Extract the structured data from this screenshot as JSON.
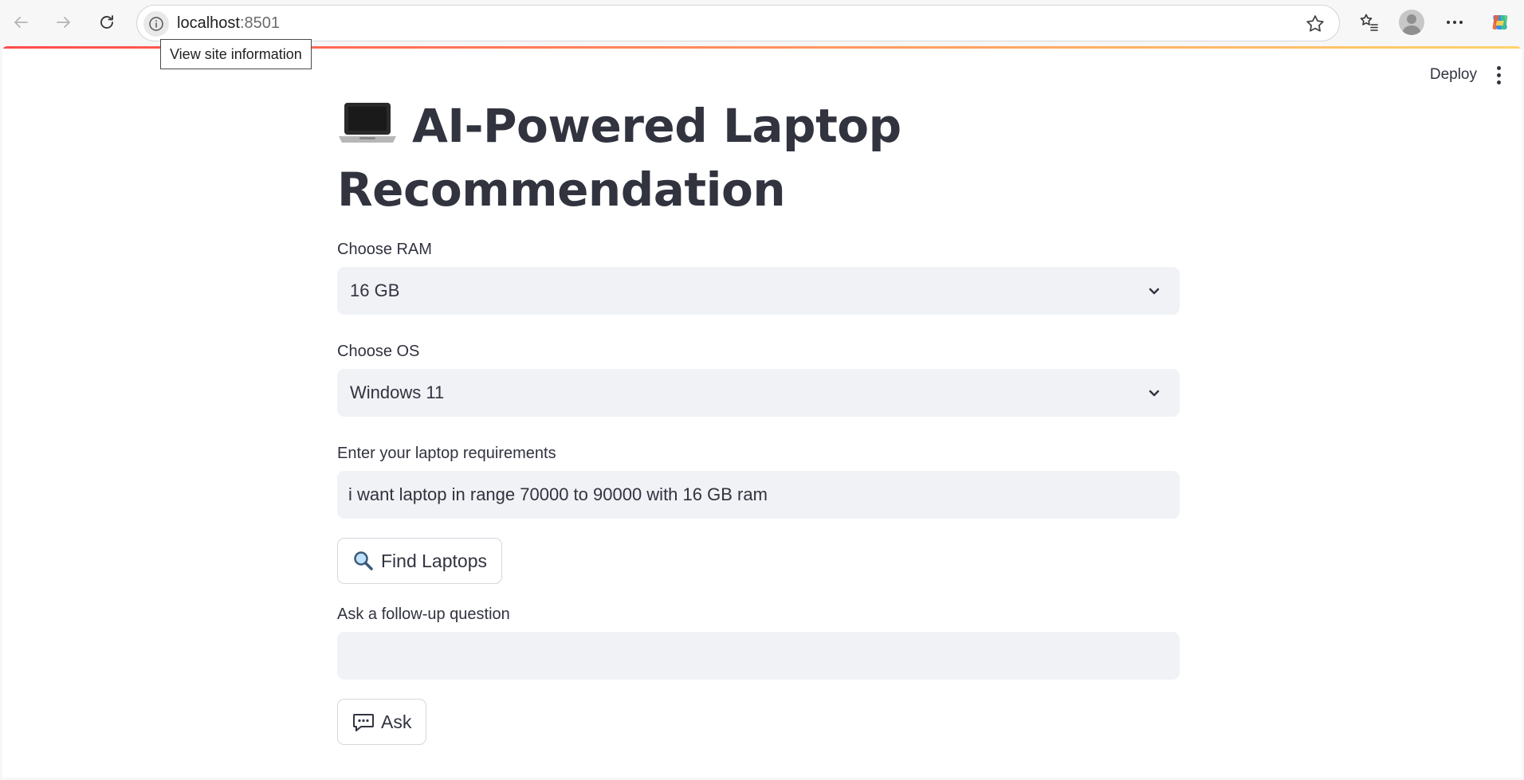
{
  "browser": {
    "url_host": "localhost",
    "url_port": ":8501",
    "tooltip": "View site information",
    "icons": [
      "back-icon",
      "forward-icon",
      "refresh-icon",
      "site-info-icon",
      "favorite-star-icon",
      "favorites-list-icon",
      "profile-avatar-icon",
      "more-options-icon",
      "copilot-icon"
    ]
  },
  "app_header": {
    "deploy_label": "Deploy",
    "decoration_colors": [
      "#ff4b4b",
      "#ffd36e"
    ]
  },
  "main": {
    "title_emoji": "laptop-icon",
    "title": "AI-Powered Laptop Recommendation",
    "ram": {
      "label": "Choose RAM",
      "selected": "16 GB"
    },
    "os": {
      "label": "Choose OS",
      "selected": "Windows 11"
    },
    "requirements": {
      "label": "Enter your laptop requirements",
      "value": "i want laptop in range 70000 to 90000 with 16 GB ram"
    },
    "find_button": {
      "icon": "magnifier-icon",
      "label": "Find Laptops"
    },
    "followup": {
      "label": "Ask a follow-up question",
      "value": ""
    },
    "ask_button": {
      "icon": "speech-bubble-icon",
      "label": "Ask"
    }
  },
  "colors": {
    "text": "#31333f",
    "input_bg": "#f0f2f6",
    "accent": "#ff4b4b"
  }
}
